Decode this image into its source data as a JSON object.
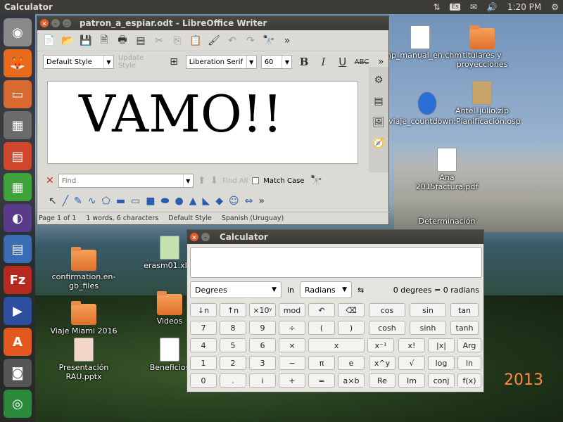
{
  "top_panel": {
    "title": "Calculator",
    "lang": "Es",
    "time": "1:20 PM"
  },
  "desktop": {
    "icons": [
      {
        "label": "php_manual_en.chm"
      },
      {
        "label": "titulares y proyecciones"
      },
      {
        "label": "viaje_countdown.Planificación.osp"
      },
      {
        "label": "Antel_julio.zip"
      },
      {
        "label": "confirmation.en-gb_files"
      },
      {
        "label": "erasm01.xlsx"
      },
      {
        "label": "Videos"
      },
      {
        "label": "Viaje Miami 2016"
      },
      {
        "label": "Presentación RAU.pptx"
      },
      {
        "label": "Beneficios"
      },
      {
        "label": "Ana 2015factura.pdf"
      },
      {
        "label": "Determinación"
      }
    ],
    "year_text": "2013"
  },
  "writer": {
    "title": "patron_a_espiar.odt - LibreOffice Writer",
    "para_style": "Default Style",
    "update_style": "Update Style",
    "font_name": "Liberation Serif",
    "font_size": "60",
    "content": "VAMO!!",
    "find_placeholder": "Find",
    "find_all": "Find All",
    "match_case": "Match Case",
    "status": {
      "page": "Page 1 of 1",
      "words": "1 words, 6 characters",
      "style": "Default Style",
      "language": "Spanish (Uruguay)"
    }
  },
  "calculator": {
    "title": "Calculator",
    "display_value": "",
    "angle_unit": "Degrees",
    "in_label": "in",
    "target_unit": "Radians",
    "conversion_result": "0 degrees = 0 radians",
    "keys": [
      [
        "↓n",
        "↑n",
        "×10ʸ",
        "mod",
        "↶",
        "⌫",
        "cos",
        "sin",
        "tan"
      ],
      [
        "7",
        "8",
        "9",
        "÷",
        "(",
        ")",
        "cosh",
        "sinh",
        "tanh"
      ],
      [
        "4",
        "5",
        "6",
        "×",
        "x",
        "x⁻¹",
        "x!",
        "|x|",
        "Arg"
      ],
      [
        "1",
        "2",
        "3",
        "−",
        "π",
        "e",
        "x^y",
        "√",
        "log",
        "ln"
      ],
      [
        "0",
        ".",
        "i",
        "+",
        "=",
        "a×b",
        "Re",
        "Im",
        "conj",
        "f(x)"
      ]
    ]
  }
}
